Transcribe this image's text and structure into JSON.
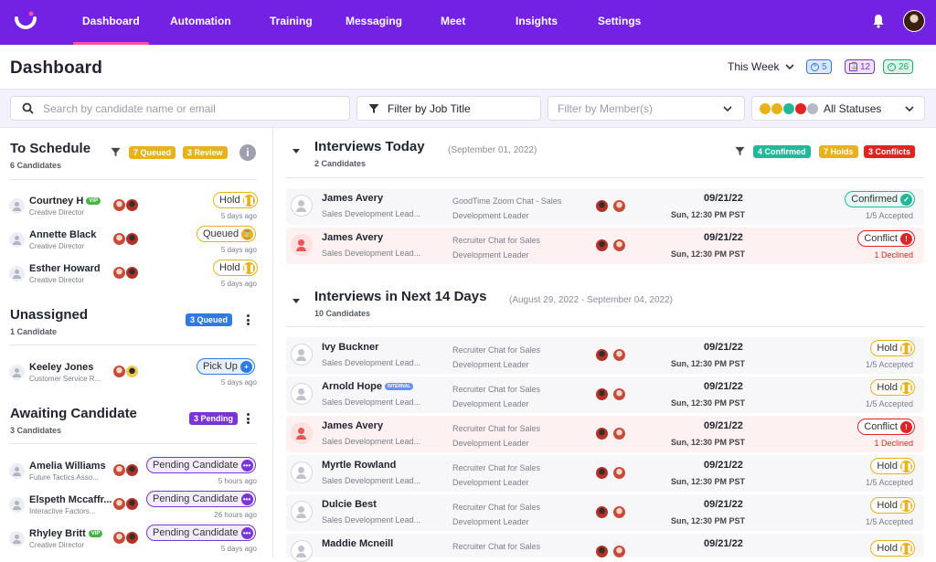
{
  "nav": {
    "tabs": [
      {
        "label": "Dashboard",
        "active": true
      },
      {
        "label": "Automation"
      },
      {
        "label": "Training"
      },
      {
        "label": "Messaging"
      },
      {
        "label": "Meet"
      },
      {
        "label": "Insights"
      },
      {
        "label": "Settings"
      }
    ]
  },
  "header": {
    "title": "Dashboard",
    "week_label": "This Week",
    "counts": [
      {
        "value": "5",
        "color": "#2e7be6",
        "bg": "#dbe8fb",
        "icon": "plus-circle-icon"
      },
      {
        "value": "12",
        "color": "#7a34d8",
        "bg": "#ece2fa",
        "icon": "hourglass-icon"
      },
      {
        "value": "26",
        "color": "#22a86d",
        "bg": "#ddf3e7",
        "icon": "check-circle-icon"
      }
    ]
  },
  "filters": {
    "search_placeholder": "Search by candidate name or email",
    "job_title_label": "Filter by Job Title",
    "member_placeholder": "Filter by Member(s)",
    "status_label": "All Statuses"
  },
  "left": {
    "to_schedule": {
      "title": "To Schedule",
      "sub": "6 Candidates",
      "badge_queued": "7 Queued",
      "badge_review": "3 Review",
      "rows": [
        {
          "name": "Courtney H",
          "vip": "VIP",
          "role": "Creative Director",
          "status": "Hold",
          "time": "5 days ago"
        },
        {
          "name": "Annette Black",
          "role": "Creative Director",
          "status": "Queued",
          "time": "5 days ago"
        },
        {
          "name": "Esther Howard",
          "role": "Creative Director",
          "status": "Hold",
          "time": "5 days ago"
        }
      ]
    },
    "unassigned": {
      "title": "Unassigned",
      "sub": "1 Candidate",
      "badge": "3 Queued",
      "rows": [
        {
          "name": "Keeley Jones",
          "role": "Customer Service R...",
          "status": "Pick Up",
          "time": "5 days ago"
        }
      ]
    },
    "awaiting": {
      "title": "Awaiting Candidate",
      "sub": "3 Candidates",
      "badge": "3 Pending",
      "rows": [
        {
          "name": "Amelia Williams",
          "role": "Future Tactics Asso...",
          "status": "Pending Candidate",
          "time": "5 hours ago"
        },
        {
          "name": "Elspeth Mccaffr...",
          "role": "Interactive Factors...",
          "status": "Pending Candidate",
          "time": "26 hours ago"
        },
        {
          "name": "Rhyley Britt",
          "vip": "VIP",
          "role": "Creative Director",
          "status": "Pending Candidate",
          "time": "5 days ago"
        }
      ]
    }
  },
  "today": {
    "title": "Interviews Today",
    "date": "(September 01, 2022)",
    "sub": "2 Candidates",
    "badge_confirmed": "4 Confirmed",
    "badge_holds": "7 Holds",
    "badge_conflicts": "3 Conflicts",
    "rows": [
      {
        "name": "James Avery",
        "role": "Sales Development Lead...",
        "meet": "GoodTime Zoom Chat - Sales Development Leader",
        "date": "09/21/22",
        "time": "Sun, 12:30 PM PST",
        "status": "Confirmed",
        "acc": "1/5 Accepted"
      },
      {
        "name": "James Avery",
        "role": "Sales Development Lead...",
        "meet": "Recruiter Chat for Sales Development Leader",
        "date": "09/21/22",
        "time": "Sun, 12:30 PM PST",
        "status": "Conflict",
        "acc": "1 Declined"
      }
    ]
  },
  "next14": {
    "title": "Interviews in Next 14 Days",
    "date": "(August 29, 2022 - September 04, 2022)",
    "sub": "10 Candidates",
    "rows": [
      {
        "name": "Ivy Buckner",
        "role": "Sales Development Lead...",
        "meet": "Recruiter Chat for Sales Development Leader",
        "date": "09/21/22",
        "time": "Sun, 12:30 PM PST",
        "status": "Hold",
        "acc": "1/5 Accepted"
      },
      {
        "name": "Arnold Hope",
        "internal": "INTERNAL",
        "role": "Sales Development Lead...",
        "meet": "Recruiter Chat for Sales Development Leader",
        "date": "09/21/22",
        "time": "Sun, 12:30 PM PST",
        "status": "Hold",
        "acc": "1/5 Accepted"
      },
      {
        "name": "James Avery",
        "role": "Sales Development Lead...",
        "meet": "Recruiter Chat for Sales Development Leader",
        "date": "09/21/22",
        "time": "Sun, 12:30 PM PST",
        "status": "Conflict",
        "acc": "1 Declined"
      },
      {
        "name": "Myrtle Rowland",
        "role": "Sales Development Lead...",
        "meet": "Recruiter Chat for Sales Development Leader",
        "date": "09/21/22",
        "time": "Sun, 12:30 PM PST",
        "status": "Hold",
        "acc": "1/5 Accepted"
      },
      {
        "name": "Dulcie Best",
        "role": "Sales Development Lead...",
        "meet": "Recruiter Chat for Sales Development Leader",
        "date": "09/21/22",
        "time": "Sun, 12:30 PM PST",
        "status": "Hold",
        "acc": "1/5 Accepted"
      },
      {
        "name": "Maddie Mcneill",
        "role": "",
        "meet": "Recruiter Chat for Sales",
        "date": "09/21/22",
        "time": "",
        "status": "Hold",
        "acc": ""
      }
    ]
  }
}
